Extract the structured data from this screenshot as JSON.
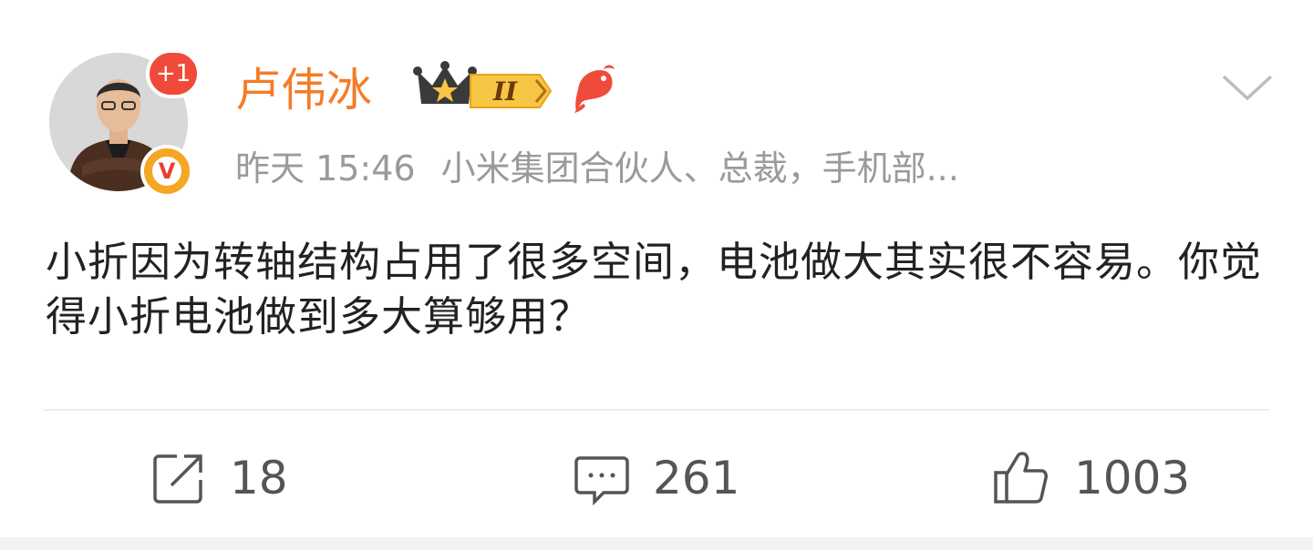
{
  "user": {
    "name": "卢伟冰",
    "plus_badge": "+1",
    "verified_mark": "V",
    "level_badge": "II"
  },
  "meta": {
    "time": "昨天 15:46",
    "description": "小米集团合伙人、总裁，手机部..."
  },
  "post": {
    "text": "小折因为转轴结构占用了很多空间，电池做大其实很不容易。你觉得小折电池做到多大算够用？"
  },
  "actions": {
    "repost_count": "18",
    "comment_count": "261",
    "like_count": "1003"
  },
  "icons": [
    "crown-icon",
    "fish-icon",
    "chevron-down-icon",
    "repost-icon",
    "comment-icon",
    "like-icon"
  ],
  "colors": {
    "username": "#f57c28",
    "badge_red": "#f04b3a",
    "verified_gold": "#f5a623",
    "meta_gray": "#9a9a9a"
  }
}
